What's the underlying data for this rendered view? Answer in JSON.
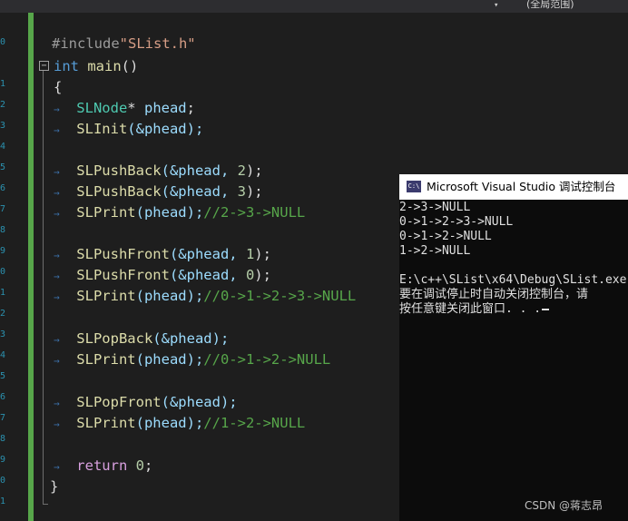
{
  "topbar": {
    "dropdown_icon": "caret-down-icon",
    "scope_label": "(全局范围)"
  },
  "code": {
    "include_directive": "#include",
    "include_file": "\"SList.h\"",
    "int_kw": "int",
    "main_fn": "main",
    "main_parens": "()",
    "brace_open": "{",
    "brace_close": "}",
    "lines": [
      {
        "type": "SLNode",
        "star": "*",
        "var": "phead",
        "semi": ";"
      },
      {
        "fn": "SLInit",
        "args": "(&phead);"
      },
      {
        "fn": "SLPushBack",
        "arg1": "(&phead,",
        "num": "2",
        "close": ");"
      },
      {
        "fn": "SLPushBack",
        "arg1": "(&phead,",
        "num": "3",
        "close": ");"
      },
      {
        "fn": "SLPrint",
        "args": "(phead);",
        "comment": "//2->3->NULL"
      },
      {
        "fn": "SLPushFront",
        "arg1": "(&phead,",
        "num": "1",
        "close": ");"
      },
      {
        "fn": "SLPushFront",
        "arg1": "(&phead,",
        "num": "0",
        "close": ");"
      },
      {
        "fn": "SLPrint",
        "args": "(phead);",
        "comment": "//0->1->2->3->NULL"
      },
      {
        "fn": "SLPopBack",
        "args": "(&phead);"
      },
      {
        "fn": "SLPrint",
        "args": "(phead);",
        "comment": "//0->1->2->NULL"
      },
      {
        "fn": "SLPopFront",
        "args": "(&phead);"
      },
      {
        "fn": "SLPrint",
        "args": "(phead);",
        "comment": "//1->2->NULL"
      },
      {
        "kw": "return",
        "num": "0",
        "semi": ";"
      }
    ]
  },
  "console": {
    "icon": "console-app-icon",
    "icon_text": "C:\\",
    "title": "Microsoft Visual Studio 调试控制台",
    "output": [
      "2->3->NULL",
      "0->1->2->3->NULL",
      "0->1->2->NULL",
      "1->2->NULL",
      "",
      "E:\\c++\\SList\\x64\\Debug\\SList.exe",
      "要在调试停止时自动关闭控制台，请",
      "按任意键关闭此窗口. . ."
    ]
  },
  "watermark": "CSDN @蒋志昂"
}
